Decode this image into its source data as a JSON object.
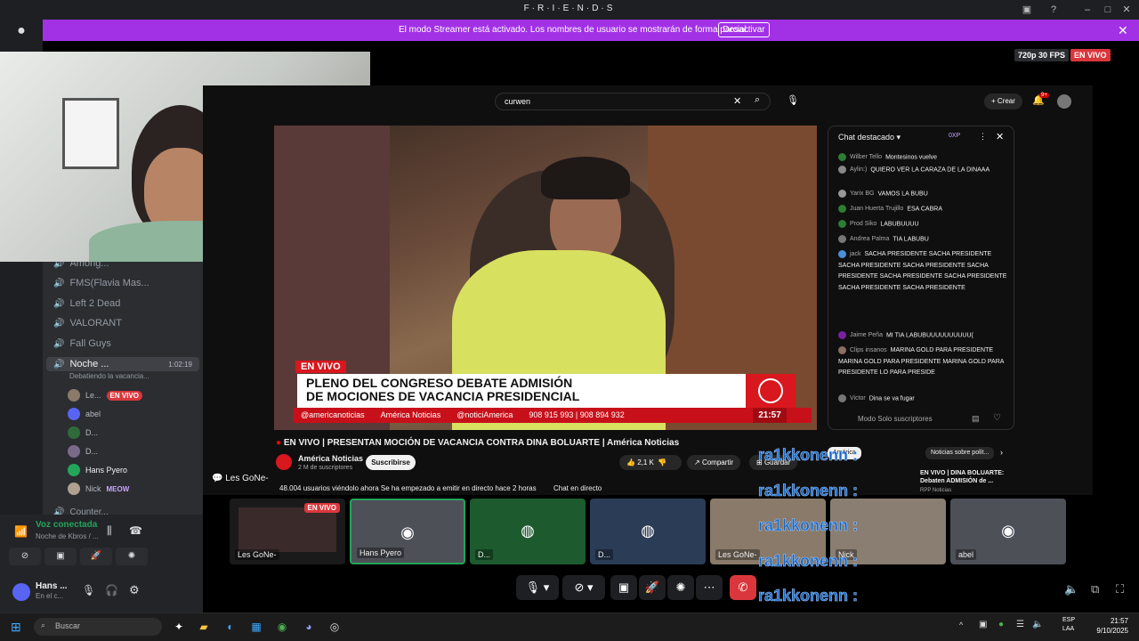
{
  "app": {
    "title": "F·R·I·E·N·D·S"
  },
  "streamer": {
    "text": "El modo Streamer está activado. Los nombres de usuario se mostrarán de forma parcial.",
    "button": "Desactivar"
  },
  "stream": {
    "quality": "720p 30 FPS",
    "live": "EN VIVO"
  },
  "sidebar": {
    "channels": [
      {
        "label": "Among..."
      },
      {
        "label": "FMS(Flavia Mas..."
      },
      {
        "label": "Left 2 Dead"
      },
      {
        "label": "VALORANT"
      },
      {
        "label": "Fall Guys"
      },
      {
        "label": "Noche ...",
        "time": "1:02:19",
        "sub": "Debatiendo la vacancia..."
      }
    ],
    "voice_users": [
      {
        "name": "Le...",
        "badge": "EN VIVO"
      },
      {
        "name": "abel"
      },
      {
        "name": "D..."
      },
      {
        "name": "D..."
      },
      {
        "name": "Hans Pyero"
      },
      {
        "name": "Nick",
        "badge": "MEOW"
      }
    ],
    "next_channel": "Counter..."
  },
  "youtube": {
    "search_value": "curwen",
    "create": "Crear",
    "notif_count": "9+",
    "title": "EN VIVO | PRESENTAN MOCIÓN DE VACANCIA CONTRA DINA BOLUARTE | América Noticias",
    "channel": "América Noticias",
    "subs": "2 M de suscriptores",
    "subscribe": "Suscribirse",
    "likes": "2,1 K",
    "share": "Compartir",
    "save": "Guardar",
    "viewers": "48.004 usuarios viéndolo ahora  Se ha empezado a emitir en directo hace 2 horas",
    "live_chat": "Chat en directo",
    "rec_tabs": [
      "América",
      "Noticias sobre polít..."
    ],
    "rec_title": "EN VIVO | DINA BOLUARTE: Debaten ADMISIÓN de ...",
    "rec_channel": "RPP Noticias"
  },
  "chyron": {
    "live": "EN VIVO",
    "line1": "PLENO DEL CONGRESO DEBATE ADMISIÓN",
    "line2": "DE MOCIONES DE VACANCIA PRESIDENCIAL",
    "social": [
      "@americanoticias",
      "América Noticias",
      "@noticiAmerica",
      "908 915 993 | 908 894 932"
    ],
    "time": "21:57"
  },
  "chat": {
    "header": "Chat destacado",
    "points": "0XP",
    "messages": [
      {
        "user": "Wilber Tello",
        "text": "Montesinos vuelve"
      },
      {
        "user": "Aylin:)",
        "text": "QUIERO VER LA CARAZA DE LA DINAAA"
      },
      {
        "user": "Yarix BG",
        "text": "VAMOS LA BUBU"
      },
      {
        "user": "Juan Huerta Trujillo",
        "text": "ESA CABRA"
      },
      {
        "user": "Prod Siko",
        "text": "LABUBUUUU"
      },
      {
        "user": "Andrea Palma",
        "text": "TIA LABUBU"
      },
      {
        "user": "jack",
        "text": "SACHA PRESIDENTE SACHA PRESIDENTE SACHA PRESIDENTE SACHA PRESIDENTE SACHA PRESIDENTE SACHA PRESIDENTE SACHA PRESIDENTE SACHA PRESIDENTE SACHA PRESIDENTE"
      },
      {
        "user": "Jaime Peña",
        "text": "MI TIA LABUBUUUUUUUUUU("
      },
      {
        "user": "Clips insanos",
        "text": "MARINA GOLD PARA PRESIDENTE MARINA GOLD PARA PRESIDENTE MARINA GOLD PARA PRESIDENTE LO PARA PRESIDE"
      },
      {
        "user": "Victor",
        "text": "Dina se va fugar"
      }
    ],
    "footer": "Modo Solo suscriptores"
  },
  "tiles": [
    {
      "label": "Les GoNe-",
      "badge": "EN VIVO"
    },
    {
      "label": "Hans Pyero"
    },
    {
      "label": "D..."
    },
    {
      "label": "D..."
    },
    {
      "label": "Les GoNe-"
    },
    {
      "label": "Nick"
    },
    {
      "label": "abel"
    }
  ],
  "les_gone_label": "Les GoNe-",
  "overlay_chat": "ra1kkonenn :",
  "voice": {
    "status": "Voz conectada",
    "sub": "Noche de Kbros / ..."
  },
  "user": {
    "name": "Hans ...",
    "status": "En el c..."
  },
  "taskbar": {
    "search": "Buscar",
    "lang1": "ESP",
    "lang2": "LAA",
    "time": "21:57",
    "date": "9/10/2025"
  }
}
